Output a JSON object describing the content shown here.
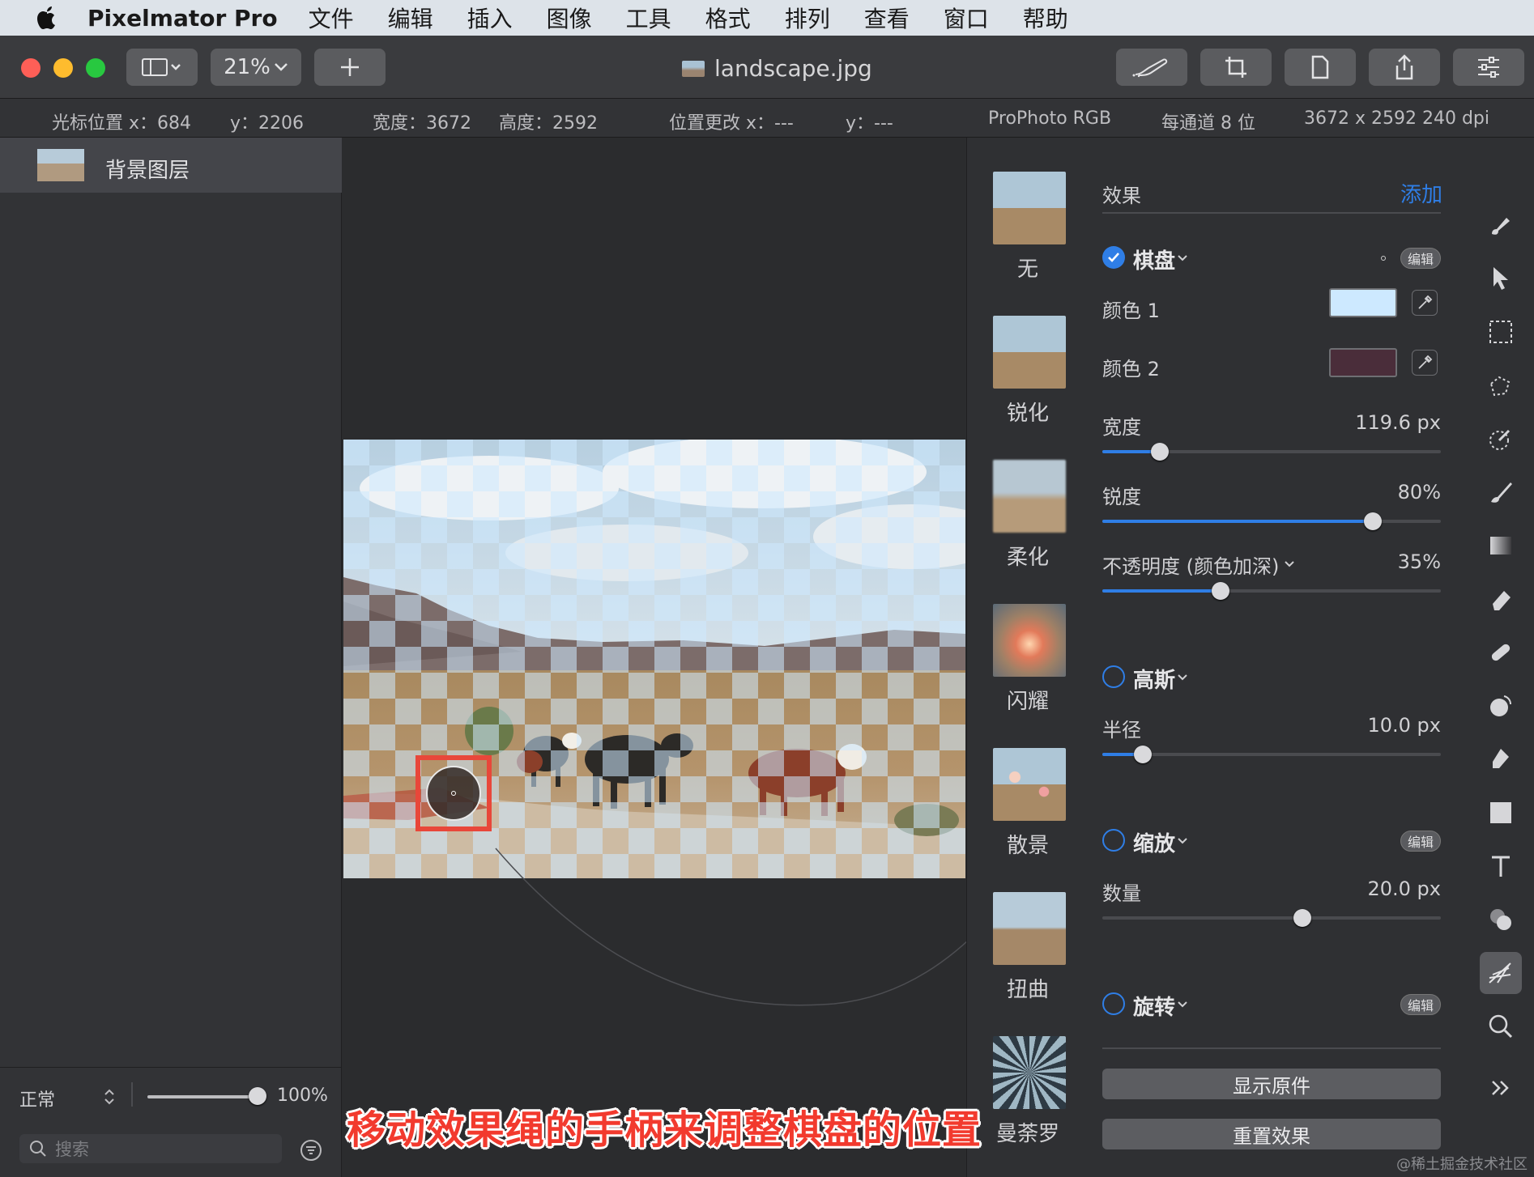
{
  "menubar": {
    "app_name": "Pixelmator Pro",
    "items": [
      "文件",
      "编辑",
      "插入",
      "图像",
      "工具",
      "格式",
      "排列",
      "查看",
      "窗口",
      "帮助"
    ]
  },
  "toolbar": {
    "zoom": "21%",
    "doc_title": "landscape.jpg"
  },
  "infobar": {
    "cursor_x": "光标位置 x：684",
    "cursor_y": "y：2206",
    "width": "宽度：3672",
    "height": "高度：2592",
    "pos_change_x": "位置更改 x：---",
    "pos_change_y": "y：---",
    "color_profile": "ProPhoto RGB",
    "bits": "每通道 8 位",
    "dims": "3672 x 2592 240 dpi"
  },
  "layers": {
    "layer_name": "背景图层",
    "blend_mode": "正常",
    "opacity": "100%",
    "opacity_value": 1.0,
    "search_placeholder": "搜索"
  },
  "effects_browser": {
    "items": [
      "无",
      "锐化",
      "柔化",
      "闪耀",
      "散景",
      "扭曲",
      "曼荼罗"
    ]
  },
  "settings": {
    "header": "效果",
    "add": "添加",
    "checker": {
      "title": "棋盘",
      "edit": "编辑",
      "color1_label": "颜色 1",
      "color1": "#cde9ff",
      "color2_label": "颜色 2",
      "color2": "#4a2d3a",
      "width_label": "宽度",
      "width_value": "119.6 px",
      "width_fraction": 0.17,
      "sharpness_label": "锐度",
      "sharpness_value": "80%",
      "sharpness_fraction": 0.8,
      "opacity_label": "不透明度 (颜色加深)",
      "opacity_value": "35%",
      "opacity_fraction": 0.35
    },
    "gaussian": {
      "title": "高斯",
      "radius_label": "半径",
      "radius_value": "10.0 px",
      "radius_fraction": 0.12
    },
    "zoom": {
      "title": "缩放",
      "edit": "编辑",
      "amount_label": "数量",
      "amount_value": "20.0 px",
      "amount_fraction": 0.59
    },
    "rotate": {
      "title": "旋转",
      "edit": "编辑"
    },
    "show_original": "显示原件",
    "reset_effects": "重置效果"
  },
  "caption": "移动效果绳的手柄来调整棋盘的位置",
  "watermark": "@稀土掘金技术社区",
  "colors": {
    "accent": "#2f7ee6",
    "highlight_box": "#e8473a"
  }
}
